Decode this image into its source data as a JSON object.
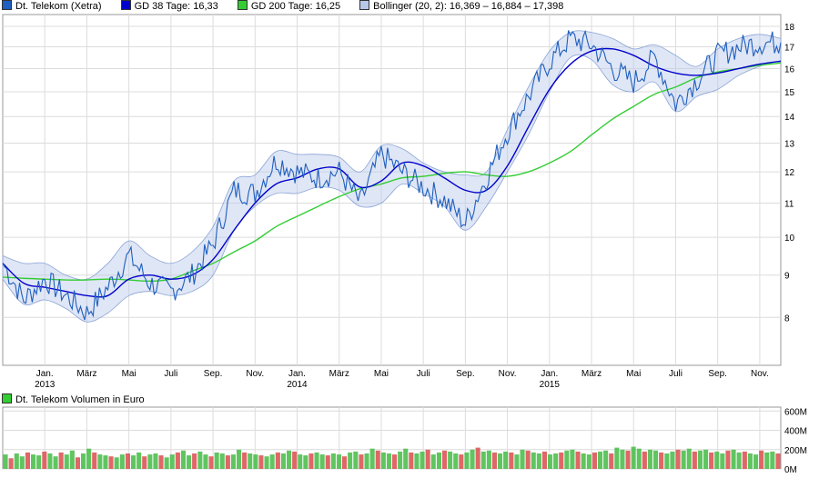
{
  "legend": {
    "price": {
      "label": "Dt. Telekom (Xetra)",
      "color": "#1f5fbf"
    },
    "gd38": {
      "label": "GD 38 Tage: 16,33",
      "color": "#0000cc"
    },
    "gd200": {
      "label": "GD 200 Tage: 16,25",
      "color": "#33cc33"
    },
    "bollinger": {
      "label": "Bollinger (20, 2): 16,369 – 16,884 – 17,398",
      "color": "#b8c8e8"
    }
  },
  "volume_legend": {
    "label": "Dt. Telekom Volumen in Euro",
    "color": "#33cc33"
  },
  "chart_data": [
    {
      "type": "line",
      "title": "",
      "y_ticks": [
        8,
        9,
        10,
        11,
        12,
        13,
        14,
        15,
        16,
        17,
        18
      ],
      "ylim": [
        7.0,
        18.6
      ],
      "y_scale": "log",
      "x_tick_labels": [
        {
          "label": "Jan.",
          "year": "2013"
        },
        {
          "label": "März",
          "year": ""
        },
        {
          "label": "Mai",
          "year": ""
        },
        {
          "label": "Juli",
          "year": ""
        },
        {
          "label": "Sep.",
          "year": ""
        },
        {
          "label": "Nov.",
          "year": ""
        },
        {
          "label": "Jan.",
          "year": "2014"
        },
        {
          "label": "März",
          "year": ""
        },
        {
          "label": "Mai",
          "year": ""
        },
        {
          "label": "Juli",
          "year": ""
        },
        {
          "label": "Sep.",
          "year": ""
        },
        {
          "label": "Nov.",
          "year": ""
        },
        {
          "label": "Jan.",
          "year": "2015"
        },
        {
          "label": "März",
          "year": ""
        },
        {
          "label": "Mai",
          "year": ""
        },
        {
          "label": "Juli",
          "year": ""
        },
        {
          "label": "Sep.",
          "year": ""
        },
        {
          "label": "Nov.",
          "year": ""
        }
      ],
      "x_months": [
        "2012-11",
        "2012-12",
        "2013-01",
        "2013-02",
        "2013-03",
        "2013-04",
        "2013-05",
        "2013-06",
        "2013-07",
        "2013-08",
        "2013-09",
        "2013-10",
        "2013-11",
        "2013-12",
        "2014-01",
        "2014-02",
        "2014-03",
        "2014-04",
        "2014-05",
        "2014-06",
        "2014-07",
        "2014-08",
        "2014-09",
        "2014-10",
        "2014-11",
        "2014-12",
        "2015-01",
        "2015-02",
        "2015-03",
        "2015-04",
        "2015-05",
        "2015-06",
        "2015-07",
        "2015-08",
        "2015-09",
        "2015-10",
        "2015-11",
        "2015-12"
      ],
      "series": [
        {
          "name": "Dt. Telekom (Xetra)",
          "values": [
            9.3,
            8.4,
            8.9,
            8.5,
            8.1,
            8.7,
            9.5,
            8.8,
            8.6,
            9.0,
            9.8,
            11.4,
            11.3,
            12.4,
            12.0,
            11.8,
            12.0,
            11.0,
            12.6,
            12.0,
            11.5,
            11.1,
            10.4,
            11.8,
            13.4,
            14.8,
            16.3,
            17.4,
            17.1,
            16.0,
            15.4,
            16.5,
            14.5,
            15.5,
            16.6,
            17.0,
            17.2,
            17.2
          ]
        },
        {
          "name": "GD 38 Tage",
          "values": [
            9.3,
            8.8,
            8.7,
            8.6,
            8.5,
            8.5,
            8.9,
            9.0,
            8.9,
            9.0,
            9.4,
            10.2,
            11.0,
            11.6,
            11.8,
            12.1,
            12.1,
            11.5,
            11.7,
            12.3,
            12.2,
            11.8,
            11.4,
            11.4,
            12.2,
            13.6,
            15.1,
            16.2,
            16.8,
            16.9,
            16.6,
            16.1,
            15.8,
            15.7,
            15.8,
            16.0,
            16.2,
            16.33
          ]
        },
        {
          "name": "GD 200 Tage",
          "values": [
            8.95,
            8.92,
            8.9,
            8.88,
            8.88,
            8.9,
            8.88,
            8.85,
            8.9,
            9.1,
            9.3,
            9.6,
            9.9,
            10.3,
            10.6,
            10.9,
            11.2,
            11.45,
            11.6,
            11.8,
            11.85,
            11.95,
            12.0,
            11.9,
            11.85,
            12.0,
            12.3,
            12.7,
            13.3,
            13.9,
            14.4,
            14.9,
            15.2,
            15.6,
            15.85,
            16.0,
            16.15,
            16.25
          ]
        },
        {
          "name": "Bollinger upper",
          "values": [
            9.5,
            9.3,
            9.3,
            9.0,
            8.9,
            9.3,
            9.9,
            9.5,
            9.3,
            9.6,
            10.3,
            11.7,
            11.9,
            12.7,
            12.6,
            12.6,
            12.5,
            12.0,
            12.9,
            12.8,
            12.3,
            12.0,
            11.9,
            12.0,
            13.5,
            15.2,
            16.8,
            17.7,
            17.7,
            17.4,
            16.9,
            17.1,
            16.6,
            16.1,
            16.9,
            17.4,
            17.6,
            17.398
          ]
        },
        {
          "name": "Bollinger lower",
          "values": [
            8.9,
            8.3,
            8.4,
            8.2,
            7.9,
            8.1,
            8.5,
            8.6,
            8.5,
            8.6,
            9.0,
            10.2,
            10.9,
            11.3,
            11.3,
            11.5,
            11.4,
            10.9,
            11.0,
            11.6,
            11.3,
            10.9,
            10.2,
            10.9,
            12.0,
            13.3,
            15.0,
            16.5,
            16.4,
            15.3,
            15.0,
            15.4,
            14.2,
            14.8,
            15.1,
            15.7,
            16.1,
            16.369
          ]
        }
      ]
    },
    {
      "type": "bar",
      "title": "",
      "y_ticks": [
        {
          "label": "0M",
          "value": 0
        },
        {
          "label": "200M",
          "value": 200
        },
        {
          "label": "400M",
          "value": 400
        },
        {
          "label": "600M",
          "value": 600
        }
      ],
      "ylim": [
        0,
        640
      ],
      "unit": "Mio. EUR",
      "weekly_volume": [
        150,
        110,
        160,
        130,
        170,
        150,
        140,
        180,
        160,
        130,
        170,
        150,
        190,
        120,
        160,
        210,
        170,
        150,
        140,
        130,
        120,
        150,
        160,
        140,
        170,
        130,
        150,
        160,
        140,
        120,
        150,
        170,
        190,
        140,
        160,
        180,
        150,
        130,
        170,
        160,
        140,
        150,
        200,
        170,
        160,
        150,
        140,
        130,
        150,
        170,
        160,
        190,
        180,
        150,
        140,
        160,
        170,
        150,
        140,
        160,
        150,
        130,
        170,
        180,
        150,
        160,
        210,
        190,
        170,
        160,
        150,
        180,
        210,
        170,
        160,
        180,
        200,
        150,
        170,
        190,
        180,
        160,
        150,
        170,
        200,
        220,
        180,
        190,
        170,
        160,
        180,
        170,
        150,
        200,
        190,
        170,
        160,
        180,
        150,
        160,
        170,
        190,
        200,
        180,
        160,
        150,
        170,
        180,
        190,
        160,
        220,
        200,
        190,
        230,
        210,
        180,
        200,
        190,
        170,
        160,
        180,
        200,
        190,
        210,
        180,
        190,
        200,
        170,
        180,
        160,
        190,
        200,
        170,
        180,
        160,
        150,
        190,
        170,
        180,
        160
      ]
    }
  ]
}
